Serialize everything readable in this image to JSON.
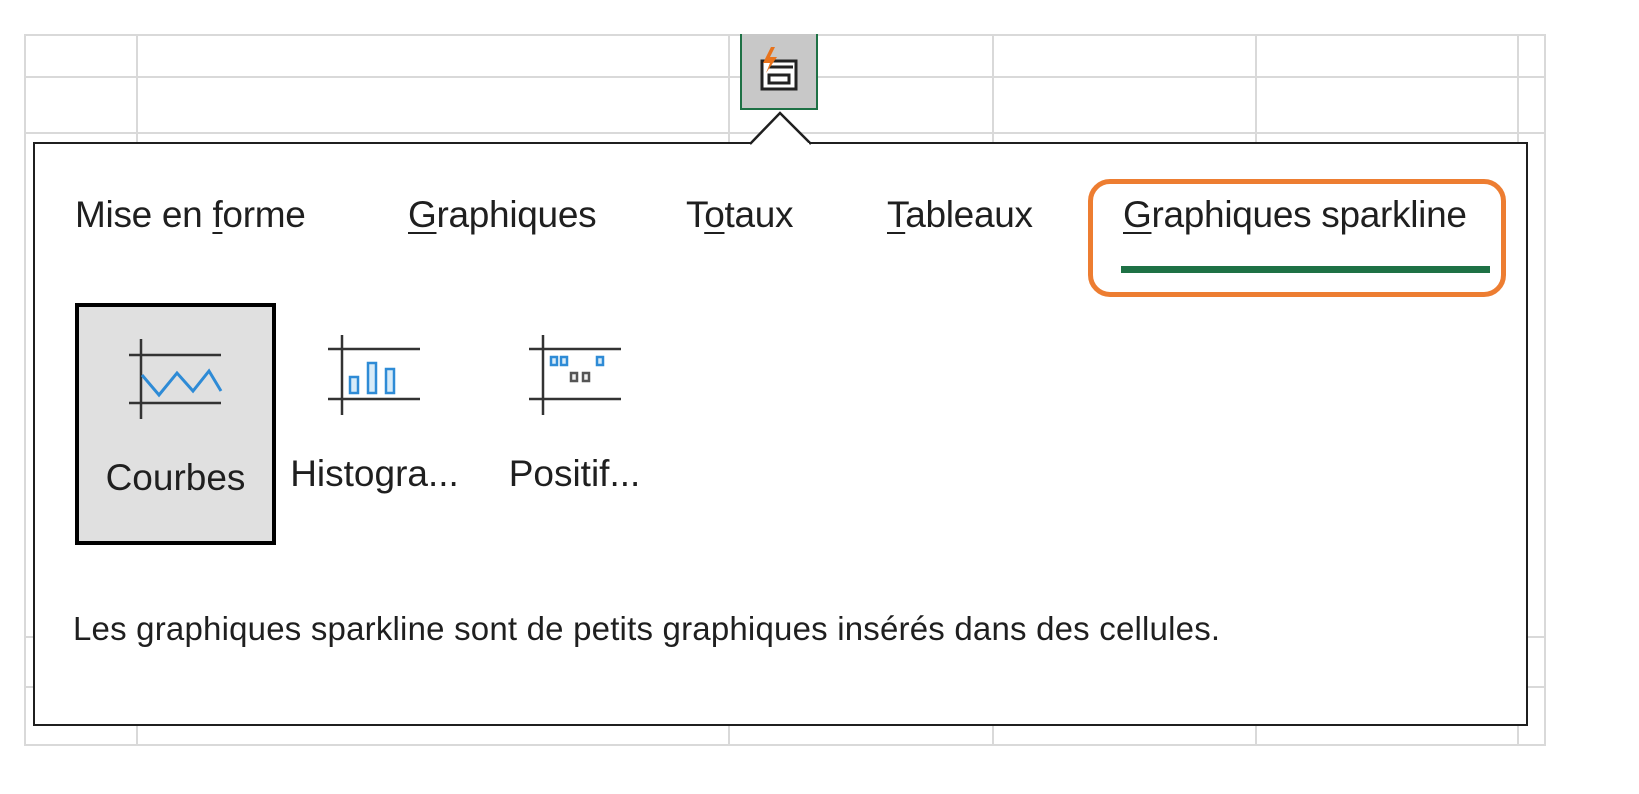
{
  "tabs": [
    {
      "pre": "Mise en ",
      "acc": "f",
      "post": "orme"
    },
    {
      "pre": "",
      "acc": "G",
      "post": "raphiques"
    },
    {
      "pre": "T",
      "acc": "o",
      "post": "taux"
    },
    {
      "pre": "",
      "acc": "T",
      "post": "ableaux"
    },
    {
      "pre": "",
      "acc": "G",
      "post": "raphiques sparkline"
    }
  ],
  "active_tab": "Graphiques sparkline",
  "options": [
    {
      "label": "Courbes",
      "selected": true,
      "icon": "sparkline-line-icon"
    },
    {
      "label": "Histogra...",
      "selected": false,
      "icon": "sparkline-column-icon"
    },
    {
      "label": "Positif...",
      "selected": false,
      "icon": "sparkline-win-loss-icon"
    }
  ],
  "description": "Les graphiques sparkline sont de petits graphiques insérés dans des cellules.",
  "colors": {
    "accent_green": "#1e7145",
    "highlight_orange": "#ed7d31",
    "sparkline_blue": "#2e8bd6"
  }
}
